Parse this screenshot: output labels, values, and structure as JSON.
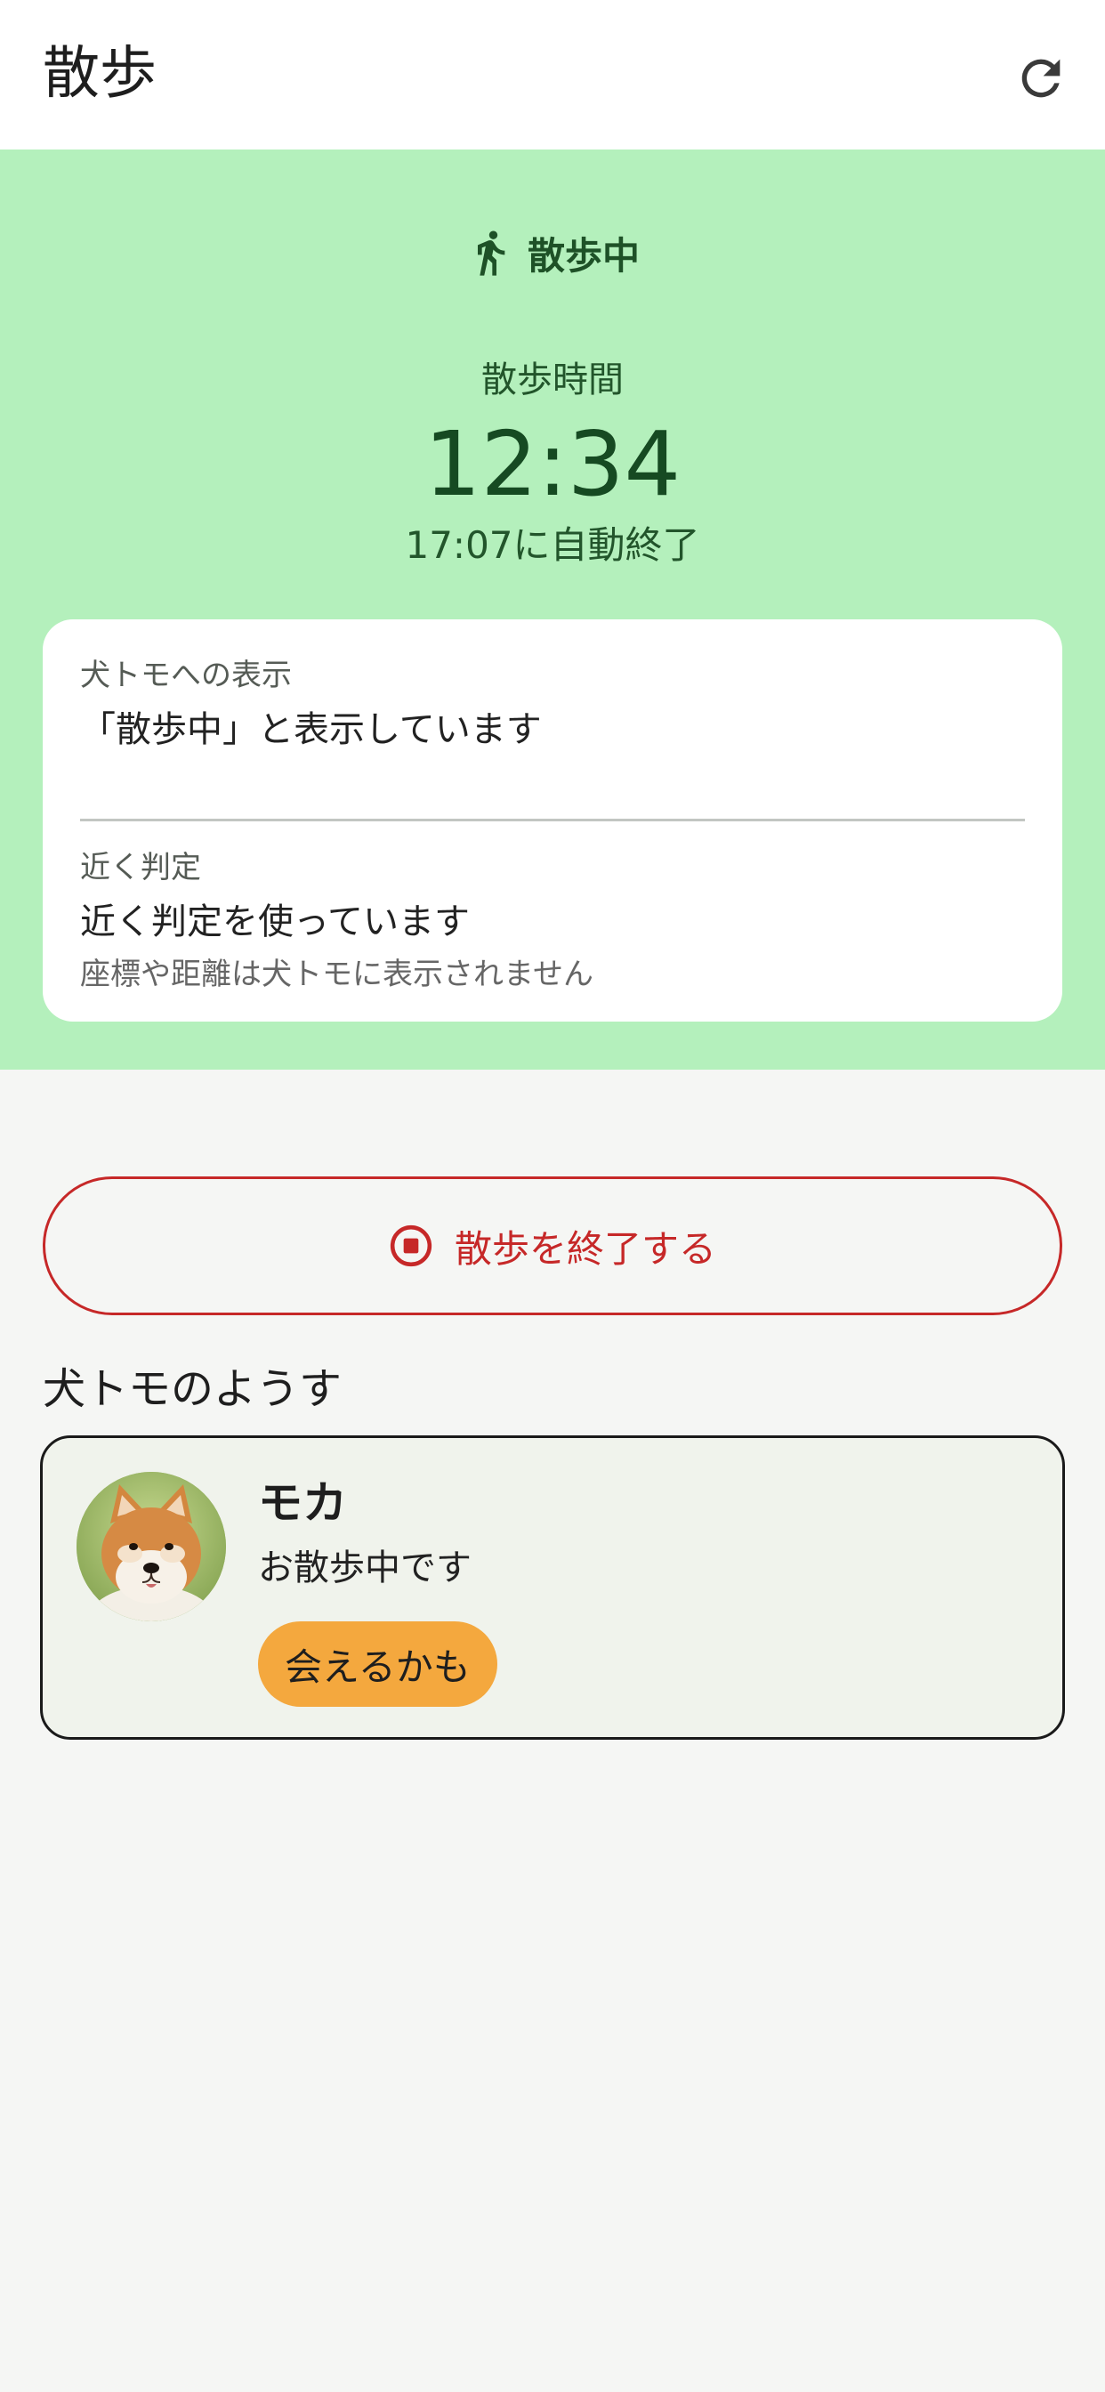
{
  "appbar": {
    "title": "散歩",
    "refresh_icon": "refresh-icon"
  },
  "hero": {
    "status_icon": "directions-walk-icon",
    "status": "散歩中",
    "walk_time_label": "散歩時間",
    "walk_time_value": "12:34",
    "auto_end": "17:07に自動終了",
    "background_color": "#b4f0bc",
    "text_color": "#1e5127"
  },
  "info_card": {
    "display": {
      "label": "犬トモへの表示",
      "value": "「散歩中」と表示しています"
    },
    "proximity": {
      "label": "近く判定",
      "value": "近く判定を使っています",
      "note": "座標や距離は犬トモに表示されません"
    }
  },
  "end_walk_button": {
    "label": "散歩を終了する",
    "icon": "stop-circle-icon",
    "color": "#c62828"
  },
  "friends_section": {
    "title": "犬トモのようす",
    "friends": [
      {
        "name": "モカ",
        "status": "お散歩中です",
        "badge": "会えるかも",
        "badge_color": "#f4a83e",
        "avatar": "shiba-dog-avatar"
      }
    ]
  }
}
